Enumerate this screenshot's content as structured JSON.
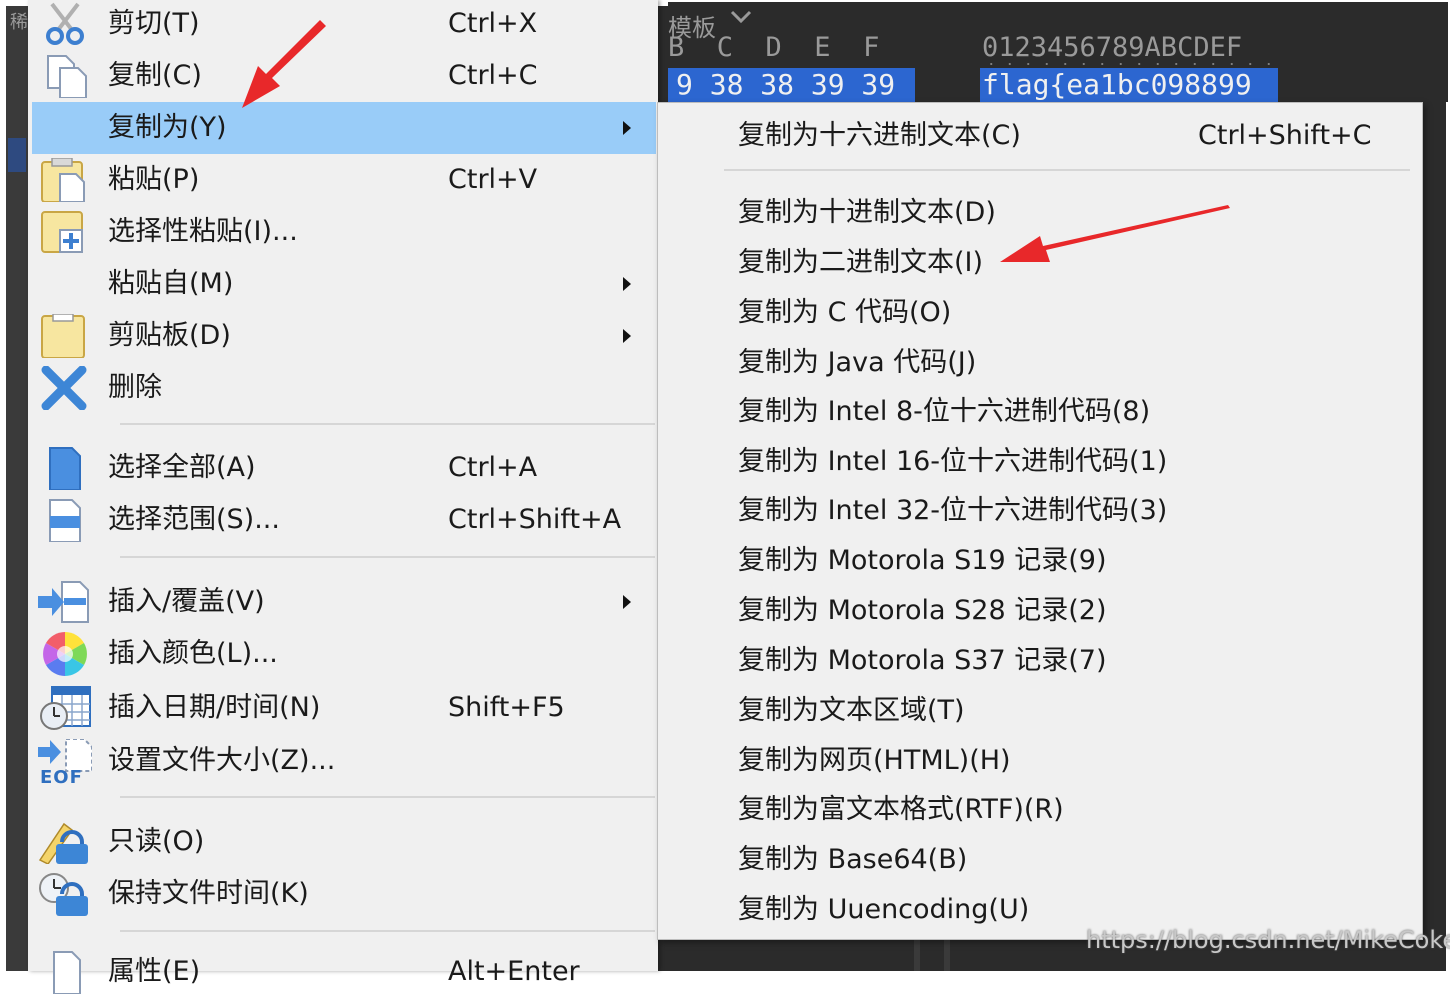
{
  "background_editor": {
    "corner_glyph": "稀",
    "template_label": "模板",
    "hex_column_header": "B  C  D  E  F",
    "ascii_column_header": "0123456789ABCDEF",
    "selected_hex_bytes": "9 38 38 39 39",
    "selected_ascii_text": "flag{ea1bc098899",
    "selection_color": "#2c66d0"
  },
  "context_menu": {
    "highlight_color": "#99ccf8",
    "items": [
      {
        "label": "剪切(T)",
        "shortcut": "Ctrl+X",
        "icon": "scissors-icon"
      },
      {
        "label": "复制(C)",
        "shortcut": "Ctrl+C",
        "icon": "copy-icon"
      },
      {
        "label": "复制为(Y)",
        "shortcut": "",
        "has_submenu": true,
        "highlighted": true
      },
      {
        "label": "粘贴(P)",
        "shortcut": "Ctrl+V",
        "icon": "paste-icon"
      },
      {
        "label": "选择性粘贴(I)...",
        "shortcut": "",
        "icon": "paste-special-icon"
      },
      {
        "label": "粘贴自(M)",
        "shortcut": "",
        "has_submenu": true
      },
      {
        "label": "剪贴板(D)",
        "shortcut": "",
        "has_submenu": true,
        "icon": "clipboard-icon"
      },
      {
        "label": "删除",
        "shortcut": "",
        "icon": "delete-x-icon"
      },
      {
        "label": "选择全部(A)",
        "shortcut": "Ctrl+A",
        "icon": "select-all-icon"
      },
      {
        "label": "选择范围(S)...",
        "shortcut": "Ctrl+Shift+A",
        "icon": "select-range-icon"
      },
      {
        "label": "插入/覆盖(V)",
        "shortcut": "",
        "has_submenu": true,
        "icon": "insert-overwrite-icon"
      },
      {
        "label": "插入颜色(L)...",
        "shortcut": "",
        "icon": "color-wheel-icon"
      },
      {
        "label": "插入日期/时间(N)",
        "shortcut": "Shift+F5",
        "icon": "calendar-clock-icon"
      },
      {
        "label": "设置文件大小(Z)...",
        "shortcut": "",
        "icon": "eof-icon",
        "icon_text": "EOF"
      },
      {
        "label": "只读(O)",
        "shortcut": "",
        "icon": "lock-pencil-icon"
      },
      {
        "label": "保持文件时间(K)",
        "shortcut": "",
        "icon": "lock-clock-icon"
      },
      {
        "label": "属性(E)",
        "shortcut": "Alt+Enter",
        "icon": "properties-icon"
      }
    ]
  },
  "copy_as_submenu": {
    "items": [
      {
        "label": "复制为十六进制文本(C)",
        "shortcut": "Ctrl+Shift+C"
      },
      {
        "label": "复制为十进制文本(D)",
        "shortcut": ""
      },
      {
        "label": "复制为二进制文本(I)",
        "shortcut": ""
      },
      {
        "label": "复制为 C 代码(O)",
        "shortcut": ""
      },
      {
        "label": "复制为 Java 代码(J)",
        "shortcut": ""
      },
      {
        "label": "复制为 Intel 8-位十六进制代码(8)",
        "shortcut": ""
      },
      {
        "label": "复制为 Intel 16-位十六进制代码(1)",
        "shortcut": ""
      },
      {
        "label": "复制为 Intel 32-位十六进制代码(3)",
        "shortcut": ""
      },
      {
        "label": "复制为 Motorola S19 记录(9)",
        "shortcut": ""
      },
      {
        "label": "复制为 Motorola S28 记录(2)",
        "shortcut": ""
      },
      {
        "label": "复制为 Motorola S37 记录(7)",
        "shortcut": ""
      },
      {
        "label": "复制为文本区域(T)",
        "shortcut": ""
      },
      {
        "label": "复制为网页(HTML)(H)",
        "shortcut": ""
      },
      {
        "label": "复制为富文本格式(RTF)(R)",
        "shortcut": ""
      },
      {
        "label": "复制为 Base64(B)",
        "shortcut": ""
      },
      {
        "label": "复制为 Uuencoding(U)",
        "shortcut": ""
      }
    ]
  },
  "annotation_arrow_color": "#e8282a",
  "watermark": "https://blog.csdn.net/MikeCoke"
}
